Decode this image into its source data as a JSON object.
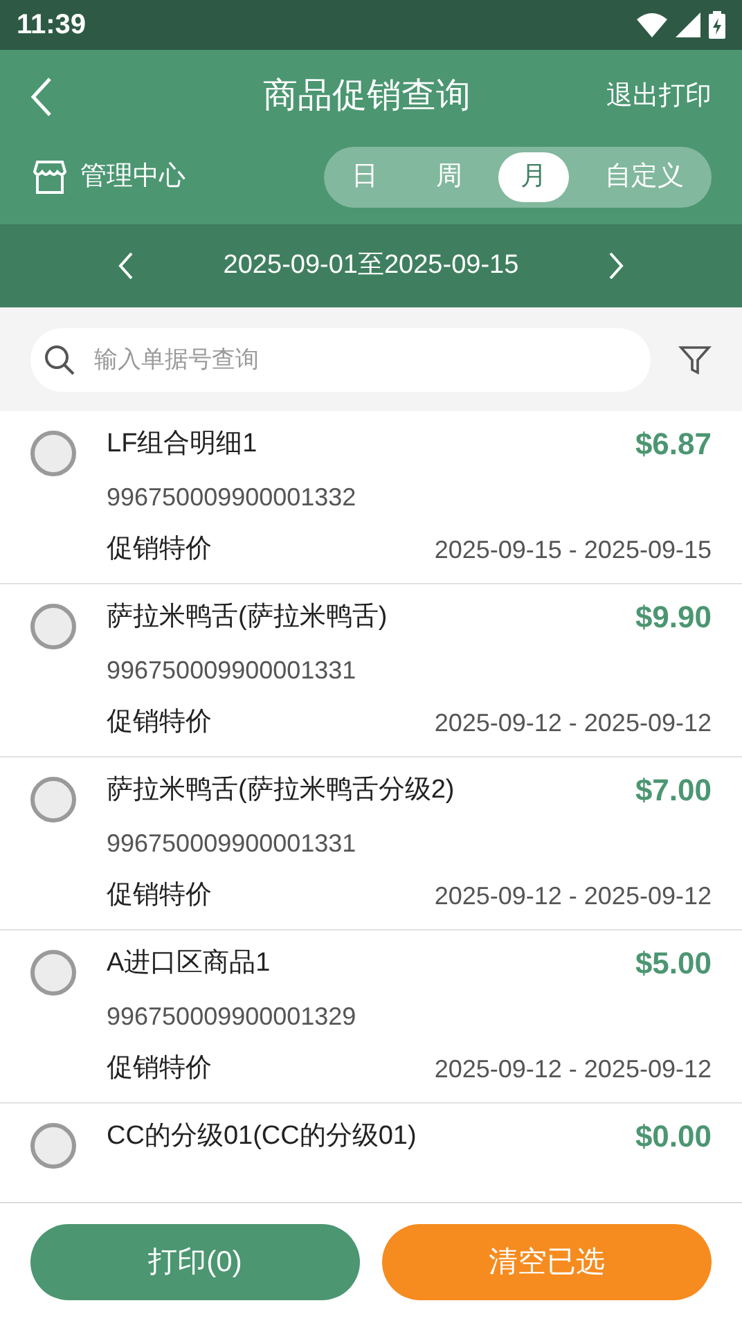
{
  "status_bar": {
    "time": "11:39"
  },
  "header": {
    "title": "商品促销查询",
    "action": "退出打印",
    "store": "管理中心"
  },
  "period_tabs": [
    {
      "label": "日",
      "selected": false
    },
    {
      "label": "周",
      "selected": false
    },
    {
      "label": "月",
      "selected": true
    },
    {
      "label": "自定义",
      "selected": false
    }
  ],
  "date_range": "2025-09-01至2025-09-15",
  "search": {
    "placeholder": "输入单据号查询"
  },
  "items": [
    {
      "name": "LF组合明细1",
      "price": "$6.87",
      "code": "996750009900001332",
      "type": "促销特价",
      "period": "2025-09-15 - 2025-09-15",
      "checked": false
    },
    {
      "name": "萨拉米鸭舌(萨拉米鸭舌)",
      "price": "$9.90",
      "code": "996750009900001331",
      "type": "促销特价",
      "period": "2025-09-12 - 2025-09-12",
      "checked": false
    },
    {
      "name": "萨拉米鸭舌(萨拉米鸭舌分级2)",
      "price": "$7.00",
      "code": "996750009900001331",
      "type": "促销特价",
      "period": "2025-09-12 - 2025-09-12",
      "checked": false
    },
    {
      "name": "A进口区商品1",
      "price": "$5.00",
      "code": "996750009900001329",
      "type": "促销特价",
      "period": "2025-09-12 - 2025-09-12",
      "checked": false
    },
    {
      "name": "CC的分级01(CC的分级01)",
      "price": "$0.00",
      "checked": false
    }
  ],
  "footer": {
    "print_button": "打印(0)",
    "clear_button": "清空已选"
  }
}
